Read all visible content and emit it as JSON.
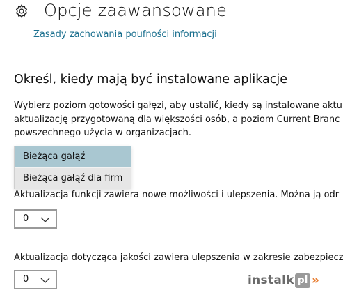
{
  "header": {
    "title": "Opcje zaawansowane",
    "icon": "gear-icon",
    "privacy_link": "Zasady zachowania poufności informacji"
  },
  "branch_section": {
    "heading": "Określ, kiedy mają być instalowane aplikacje",
    "description_lines": [
      "Wybierz poziom gotowości gałęzi, aby ustalić, kiedy są instalowane aktu",
      "aktualizację przygotowaną dla większości osób, a poziom Current Branc",
      "powszechnego użycia w organizacjach."
    ],
    "dropdown": {
      "options": [
        "Bieżąca gałąź",
        "Bieżąca gałąź dla firm"
      ],
      "selected": "Bieżąca gałąź"
    }
  },
  "feature_update": {
    "text": "Aktualizacja funkcji zawiera nowe możliwości i ulepszenia. Można ją odr",
    "value": "0"
  },
  "quality_update": {
    "text": "Aktualizacja dotycząca jakości zawiera ulepszenia w zakresie zabezpiecz",
    "value": "0"
  },
  "watermark": {
    "text": "instalki",
    "badge": "pl"
  },
  "colors": {
    "link": "#1a6f8e",
    "selected_option": "#a9c7d1",
    "watermark_accent": "#e87b2d"
  }
}
